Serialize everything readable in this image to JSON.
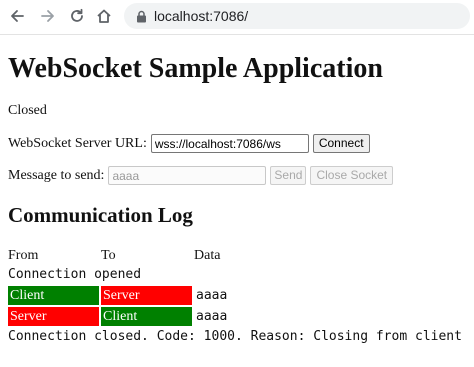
{
  "browser": {
    "url": "localhost:7086/",
    "back_icon": "arrow-left-icon",
    "forward_icon": "arrow-right-icon",
    "reload_icon": "reload-icon",
    "home_icon": "home-icon",
    "lock_icon": "lock-icon"
  },
  "page": {
    "title": "WebSocket Sample Application",
    "status": "Closed",
    "url_label": "WebSocket Server URL:",
    "url_value": "wss://localhost:7086/ws",
    "connect_label": "Connect",
    "message_label": "Message to send:",
    "message_value": "aaaa",
    "send_label": "Send",
    "close_label": "Close Socket"
  },
  "log": {
    "title": "Communication Log",
    "headers": [
      "From",
      "To",
      "Data"
    ],
    "opened_line": "Connection opened",
    "rows": [
      {
        "from": "Client",
        "to": "Server",
        "data": "aaaa"
      },
      {
        "from": "Server",
        "to": "Client",
        "data": "aaaa"
      }
    ],
    "closed_line": "Connection closed. Code: 1000. Reason: Closing from client"
  },
  "colors": {
    "client_cell": "#008000",
    "server_cell": "#ff0000"
  }
}
